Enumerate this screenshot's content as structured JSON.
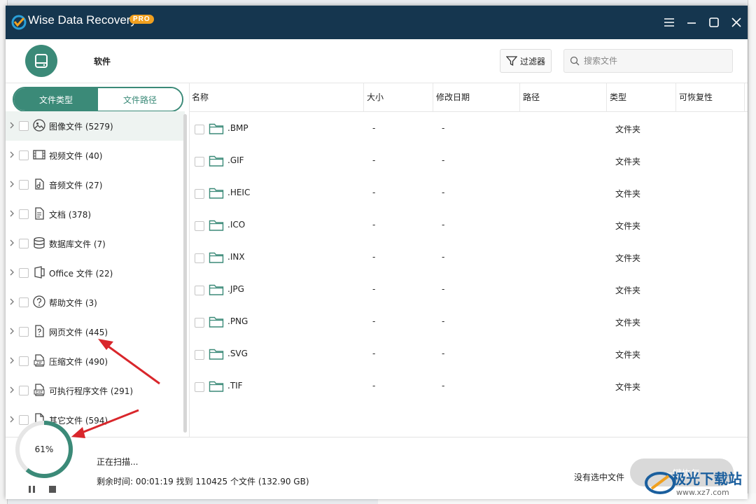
{
  "app": {
    "title": "Wise Data Recovery",
    "badge": "PRO"
  },
  "toolbar": {
    "drive_label": "软件",
    "filter_label": "过滤器",
    "search_placeholder": "搜索文件"
  },
  "sidebar": {
    "tabs": [
      {
        "label": "文件类型",
        "active": true
      },
      {
        "label": "文件路径",
        "active": false
      }
    ],
    "categories": [
      {
        "label": "图像文件 (5279)",
        "icon": "image-icon",
        "selected": true
      },
      {
        "label": "视频文件 (40)",
        "icon": "video-icon"
      },
      {
        "label": "音频文件 (27)",
        "icon": "audio-icon"
      },
      {
        "label": "文档 (378)",
        "icon": "document-icon"
      },
      {
        "label": "数据库文件 (7)",
        "icon": "database-icon"
      },
      {
        "label": "Office 文件 (22)",
        "icon": "office-icon"
      },
      {
        "label": "帮助文件 (3)",
        "icon": "help-icon"
      },
      {
        "label": "网页文件 (445)",
        "icon": "webpage-icon"
      },
      {
        "label": "压缩文件 (490)",
        "icon": "zip-icon"
      },
      {
        "label": "可执行程序文件 (291)",
        "icon": "exe-icon"
      },
      {
        "label": "其它文件 (594)",
        "icon": "other-file-icon"
      }
    ]
  },
  "table": {
    "columns": [
      "名称",
      "大小",
      "修改日期",
      "路径",
      "类型",
      "可恢复性"
    ],
    "rows": [
      {
        "name": ".BMP",
        "size": "-",
        "date": "-",
        "type": "文件夹"
      },
      {
        "name": ".GIF",
        "size": "-",
        "date": "-",
        "type": "文件夹"
      },
      {
        "name": ".HEIC",
        "size": "-",
        "date": "-",
        "type": "文件夹"
      },
      {
        "name": ".ICO",
        "size": "-",
        "date": "-",
        "type": "文件夹"
      },
      {
        "name": ".INX",
        "size": "-",
        "date": "-",
        "type": "文件夹"
      },
      {
        "name": ".JPG",
        "size": "-",
        "date": "-",
        "type": "文件夹"
      },
      {
        "name": ".PNG",
        "size": "-",
        "date": "-",
        "type": "文件夹"
      },
      {
        "name": ".SVG",
        "size": "-",
        "date": "-",
        "type": "文件夹"
      },
      {
        "name": ".TIF",
        "size": "-",
        "date": "-",
        "type": "文件夹"
      }
    ]
  },
  "status": {
    "progress_text": "61%",
    "progress_value": 0.61,
    "scan_status": "正在扫描...",
    "scan_stats": "剩余时间: 00:01:19 找到 110425 个文件 (132.90 GB)",
    "no_selection": "没有选中文件",
    "recover_button": "一键恢复"
  },
  "watermark": {
    "text": "极光下载站",
    "url": "www.xz7.com"
  },
  "colors": {
    "titlebar": "#15364f",
    "accent": "#3b8a78",
    "annotation_arrow": "#d9262b"
  }
}
